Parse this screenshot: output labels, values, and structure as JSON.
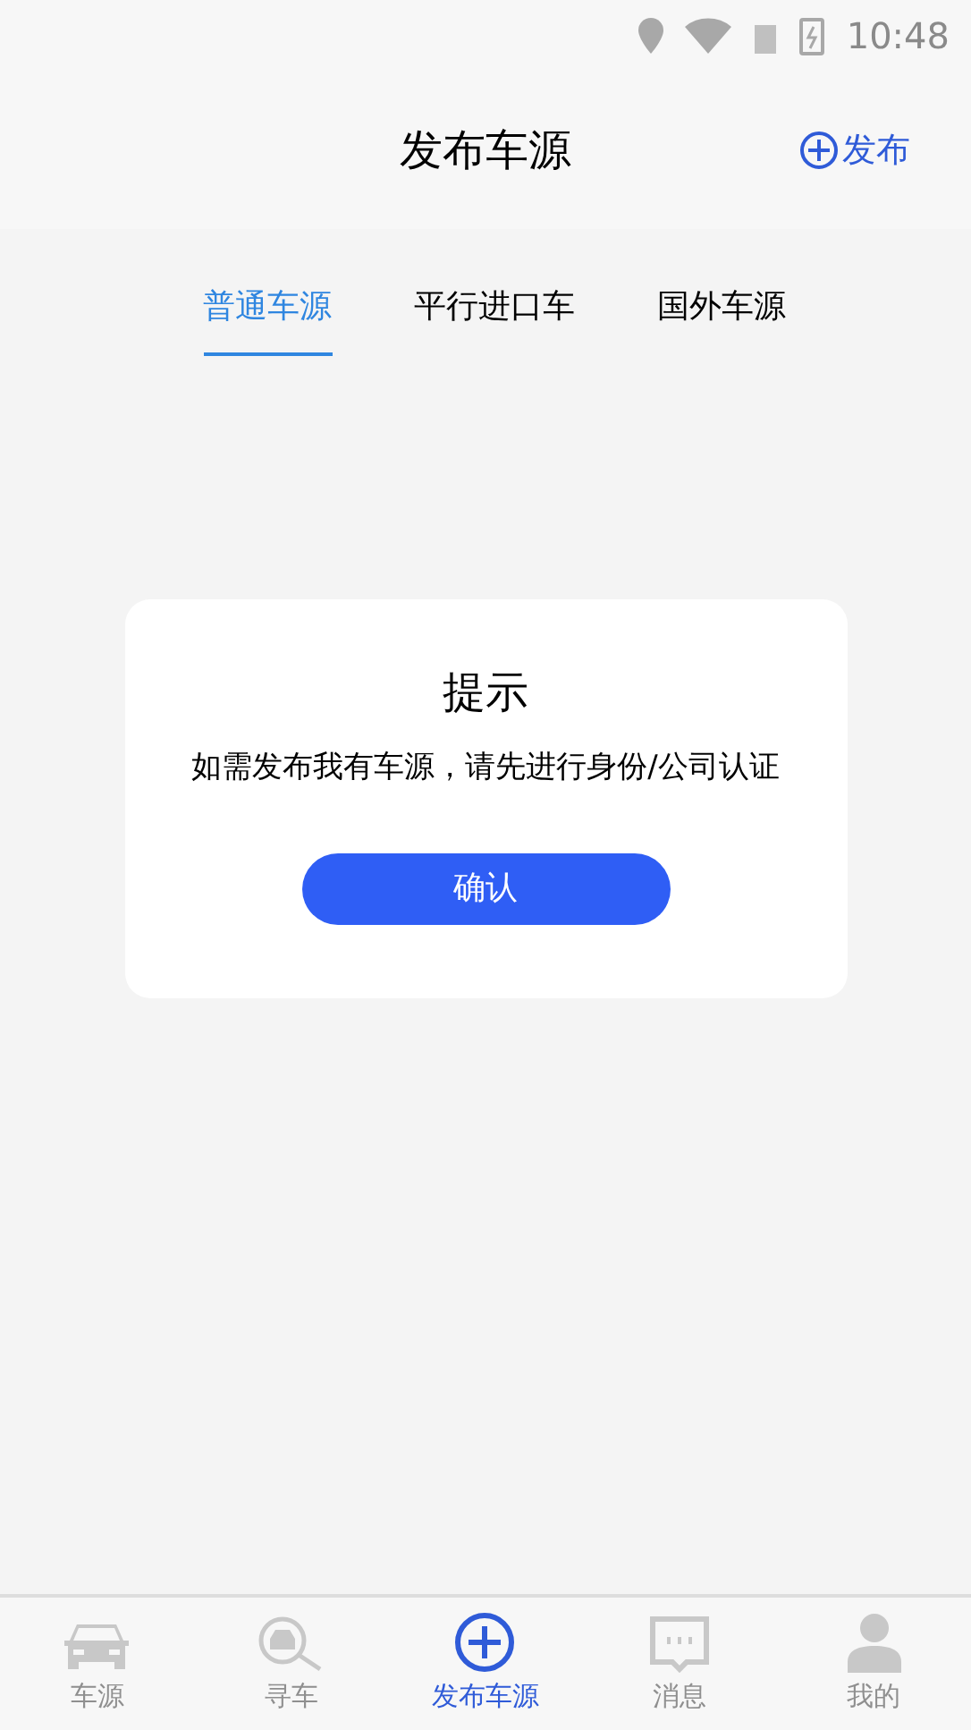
{
  "status_bar": {
    "time": "10:48"
  },
  "header": {
    "title": "发布车源",
    "action": "发布"
  },
  "tabs": [
    {
      "label": "普通车源",
      "selected": true
    },
    {
      "label": "平行进口车",
      "selected": false
    },
    {
      "label": "国外车源",
      "selected": false
    }
  ],
  "dialog": {
    "title": "提示",
    "message": "如需发布我有车源，请先进行身份/公司认证",
    "button": "确认"
  },
  "bottom_nav": [
    {
      "kind": "car",
      "label": "车源",
      "selected": false
    },
    {
      "kind": "search",
      "label": "寻车",
      "selected": false
    },
    {
      "kind": "publish",
      "label": "发布车源",
      "selected": true
    },
    {
      "kind": "message",
      "label": "消息",
      "selected": false
    },
    {
      "kind": "profile",
      "label": "我的",
      "selected": false
    }
  ]
}
